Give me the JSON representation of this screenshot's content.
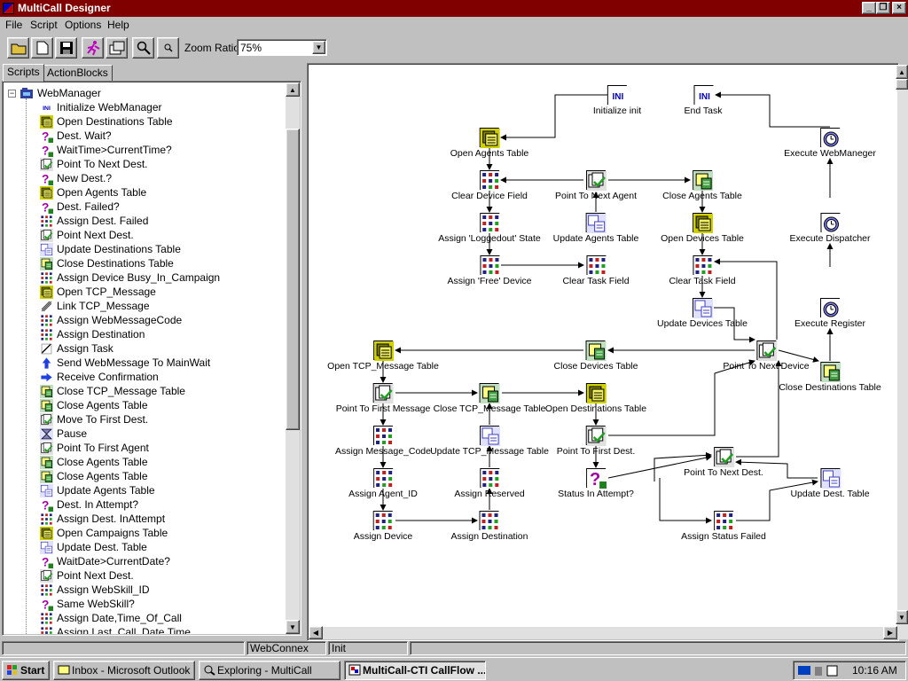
{
  "window": {
    "title": "MultiCall Designer",
    "controls": [
      "_",
      "❐",
      "×"
    ]
  },
  "menu": [
    "File",
    "Script",
    "Options",
    "Help"
  ],
  "toolbar": {
    "buttons": [
      "open-folder-icon",
      "new-file-icon",
      "save-icon",
      "run-icon",
      "compile-icon",
      "zoom-icon",
      "small-zoom-icon"
    ],
    "zoom_label": "Zoom Ratio",
    "zoom_value": "75%"
  },
  "tabs": [
    "Scripts",
    "ActionBlocks"
  ],
  "tree": {
    "root": "WebManager",
    "items": [
      {
        "label": "Initialize WebManager",
        "icon": "ini"
      },
      {
        "label": "Open Destinations Table",
        "icon": "open"
      },
      {
        "label": "Dest. Wait?",
        "icon": "question"
      },
      {
        "label": "WaitTime>CurrentTime?",
        "icon": "question"
      },
      {
        "label": "Point To Next Dest.",
        "icon": "point"
      },
      {
        "label": "New Dest.?",
        "icon": "question"
      },
      {
        "label": "Open Agents Table",
        "icon": "open"
      },
      {
        "label": "Dest. Failed?",
        "icon": "question"
      },
      {
        "label": "Assign Dest. Failed",
        "icon": "assign"
      },
      {
        "label": "Point Next Dest.",
        "icon": "point"
      },
      {
        "label": "Update Destinations Table",
        "icon": "update"
      },
      {
        "label": "Close Destinations Table",
        "icon": "close"
      },
      {
        "label": "Assign Device Busy_In_Campaign",
        "icon": "assign"
      },
      {
        "label": "Open TCP_Message",
        "icon": "open"
      },
      {
        "label": "Link TCP_Message",
        "icon": "link"
      },
      {
        "label": "Assign WebMessageCode",
        "icon": "assign"
      },
      {
        "label": "Assign Destination",
        "icon": "assign"
      },
      {
        "label": "Assign Task",
        "icon": "task"
      },
      {
        "label": "Send WebMessage To MainWait",
        "icon": "send"
      },
      {
        "label": "Receive Confirmation",
        "icon": "receive"
      },
      {
        "label": "Close TCP_Message Table",
        "icon": "close"
      },
      {
        "label": "Close Agents Table",
        "icon": "close"
      },
      {
        "label": "Move To First Dest.",
        "icon": "point"
      },
      {
        "label": "Pause",
        "icon": "pause"
      },
      {
        "label": "Point To First  Agent",
        "icon": "point"
      },
      {
        "label": "Close Agents Table",
        "icon": "close"
      },
      {
        "label": "Close Agents Table",
        "icon": "close"
      },
      {
        "label": "Update Agents Table",
        "icon": "update"
      },
      {
        "label": "Dest. In Attempt?",
        "icon": "question"
      },
      {
        "label": "Assign Dest. InAttempt",
        "icon": "assign"
      },
      {
        "label": "Open Campaigns Table",
        "icon": "open"
      },
      {
        "label": "Update Dest. Table",
        "icon": "update"
      },
      {
        "label": "WaitDate>CurrentDate?",
        "icon": "question"
      },
      {
        "label": "Point Next Dest.",
        "icon": "point"
      },
      {
        "label": "Assign WebSkill_ID",
        "icon": "assign"
      },
      {
        "label": "Same WebSkill?",
        "icon": "question"
      },
      {
        "label": "Assign Date,Time_Of_Call",
        "icon": "assign"
      },
      {
        "label": "Assign Last_Call_Date,Time",
        "icon": "assign"
      }
    ]
  },
  "flow": {
    "nodes": [
      {
        "id": "init",
        "label": "Initialize init",
        "icon": "ini"
      },
      {
        "id": "end",
        "label": "End Task",
        "icon": "ini"
      },
      {
        "id": "openAgents",
        "label": "Open Agents Table",
        "icon": "open"
      },
      {
        "id": "execWeb",
        "label": "Execute WebManeger",
        "icon": "exec"
      },
      {
        "id": "clearDev",
        "label": "Clear Device Field",
        "icon": "assign"
      },
      {
        "id": "ptNextAgent",
        "label": "Point To Next Agent",
        "icon": "point"
      },
      {
        "id": "closeAgents",
        "label": "Close Agents Table",
        "icon": "close"
      },
      {
        "id": "assignLogged",
        "label": "Assign 'Loggedout' State",
        "icon": "assign"
      },
      {
        "id": "updAgents",
        "label": "Update Agents Table",
        "icon": "update"
      },
      {
        "id": "openDevices",
        "label": "Open Devices Table",
        "icon": "open"
      },
      {
        "id": "execDisp",
        "label": "Execute Dispatcher",
        "icon": "exec"
      },
      {
        "id": "assignFree",
        "label": "Assign 'Free' Device",
        "icon": "assign"
      },
      {
        "id": "clearTask1",
        "label": "Clear Task Field",
        "icon": "assign"
      },
      {
        "id": "clearTask2",
        "label": "Clear Task Field",
        "icon": "assign"
      },
      {
        "id": "updDevices",
        "label": "Update Devices Table",
        "icon": "update"
      },
      {
        "id": "execReg",
        "label": "Execute Register",
        "icon": "exec"
      },
      {
        "id": "openTcp",
        "label": "Open TCP_Message Table",
        "icon": "open"
      },
      {
        "id": "closeDevices",
        "label": "Close Devices Table",
        "icon": "close"
      },
      {
        "id": "ptNextDevice",
        "label": "Point To Next Device",
        "icon": "point"
      },
      {
        "id": "closeDest",
        "label": "Close Destinations Table",
        "icon": "close"
      },
      {
        "id": "ptFirstMsg",
        "label": "Point To First Message",
        "icon": "point"
      },
      {
        "id": "closeTcp",
        "label": "Close TCP_Message Table",
        "icon": "close"
      },
      {
        "id": "openDest",
        "label": "Open Destinations Table",
        "icon": "open"
      },
      {
        "id": "assignMsg",
        "label": "Assign Message_Code",
        "icon": "assign"
      },
      {
        "id": "updTcp",
        "label": "Update TCP_Message Table",
        "icon": "update"
      },
      {
        "id": "ptFirstDest",
        "label": "Point To First Dest.",
        "icon": "point"
      },
      {
        "id": "ptNextDest",
        "label": "Point To Next Dest.",
        "icon": "point"
      },
      {
        "id": "updDest",
        "label": "Update Dest. Table",
        "icon": "update"
      },
      {
        "id": "assignAgent",
        "label": "Assign Agent_ID",
        "icon": "assign"
      },
      {
        "id": "assignReserved",
        "label": "Assign Reserved",
        "icon": "assign"
      },
      {
        "id": "statusAttempt",
        "label": "Status In Attempt?",
        "icon": "question"
      },
      {
        "id": "assignDevice",
        "label": "Assign Device",
        "icon": "assign"
      },
      {
        "id": "assignDest",
        "label": "Assign Destination",
        "icon": "assign"
      },
      {
        "id": "assignStatusFail",
        "label": "Assign Status Failed",
        "icon": "assign"
      }
    ]
  },
  "status": [
    "WebConnex",
    "Init"
  ],
  "taskbar": {
    "start": "Start",
    "apps": [
      "Inbox - Microsoft Outlook",
      "Exploring - MultiCall",
      "MultiCall-CTI CallFlow ..."
    ],
    "clock": "10:16 AM"
  }
}
